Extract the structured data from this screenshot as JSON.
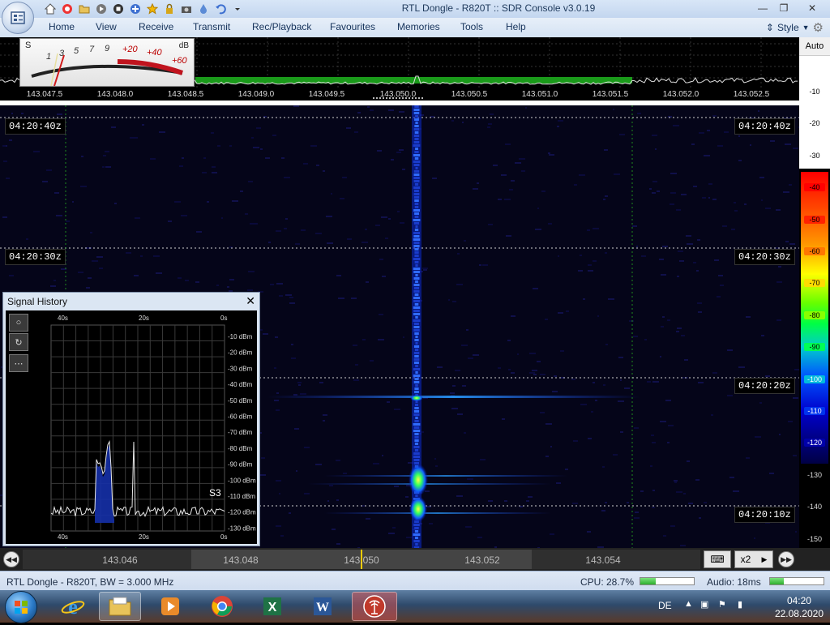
{
  "window": {
    "title": "RTL Dongle - R820T :: SDR Console v3.0.19",
    "controls": [
      "minimize",
      "restore",
      "close"
    ]
  },
  "quick_access_icons": [
    "home-icon",
    "lifebuoy-icon",
    "folder-icon",
    "play-icon",
    "stop-icon",
    "plus-icon",
    "star-icon",
    "lock-icon",
    "camera-icon",
    "drop-icon",
    "undo-icon",
    "dropdown-icon"
  ],
  "ribbon": {
    "tabs": [
      "Home",
      "View",
      "Receive",
      "Transmit",
      "Rec/Playback",
      "Favourites",
      "Memories",
      "Tools",
      "Help"
    ],
    "style_label": "Style"
  },
  "s_meter": {
    "s_label": "S",
    "db_label": "dB",
    "scale": [
      "1",
      "3",
      "5",
      "7",
      "9",
      "+20",
      "+40",
      "+60"
    ]
  },
  "freq_axis": [
    "143.047.5",
    "143.048.0",
    "143.048.5",
    "143.049.0",
    "143.049.5",
    "143.050.0",
    "143.050.5",
    "143.051.0",
    "143.051.5",
    "143.052.0",
    "143.052.5"
  ],
  "waterfall": {
    "timestamps": [
      "04:20:40z",
      "04:20:30z",
      "04:20:20z",
      "04:20:10z"
    ]
  },
  "db_scale": {
    "auto_label": "Auto",
    "ticks": [
      "-10",
      "-20",
      "-30",
      "-40",
      "-50",
      "-60",
      "-70",
      "-80",
      "-90",
      "-100",
      "-110",
      "-120",
      "-130",
      "-140",
      "-150"
    ],
    "tick_colors": [
      "#ffffff",
      "#ffffff",
      "#ffffff",
      "#ff0000",
      "#ff2200",
      "#ff7700",
      "#ffdd00",
      "#88ff00",
      "#00ff55",
      "#00bbdd",
      "#0033ee",
      "#0000aa",
      "#000022",
      "#000000",
      "#000000"
    ]
  },
  "signal_history": {
    "title": "Signal History",
    "time_top": [
      "40s",
      "20s",
      "0s"
    ],
    "time_bottom": [
      "40s",
      "20s",
      "0s"
    ],
    "dbm_labels": [
      "-10 dBm",
      "-20 dBm",
      "-30 dBm",
      "-40 dBm",
      "-50 dBm",
      "-60 dBm",
      "-70 dBm",
      "-80 dBm",
      "-90 dBm",
      "-100 dBm",
      "-110 dBm",
      "-120 dBm",
      "-130 dBm"
    ],
    "s_value": "S3",
    "buttons": [
      "circle-icon",
      "refresh-icon",
      "more-icon"
    ]
  },
  "tuning_bar": {
    "labels": [
      "143.046",
      "143.048",
      "143.050",
      "143.052",
      "143.054"
    ],
    "zoom": "x2"
  },
  "status": {
    "device": "RTL Dongle - R820T, BW = 3.000 MHz",
    "cpu": "CPU: 28.7%",
    "audio": "Audio: 18ms",
    "cpu_level": 0.287,
    "audio_level": 0.25
  },
  "taskbar": {
    "apps": [
      "explorer-icon",
      "internet-explorer-icon",
      "file-manager-icon",
      "media-player-icon",
      "chrome-icon",
      "excel-icon",
      "word-icon",
      "sdr-console-icon"
    ],
    "language": "DE",
    "time": "04:20",
    "date": "22.08.2020"
  },
  "colors": {
    "waterfall_bg": "#050519",
    "signal": "#1a4cff",
    "accent": "#ffcc00"
  }
}
